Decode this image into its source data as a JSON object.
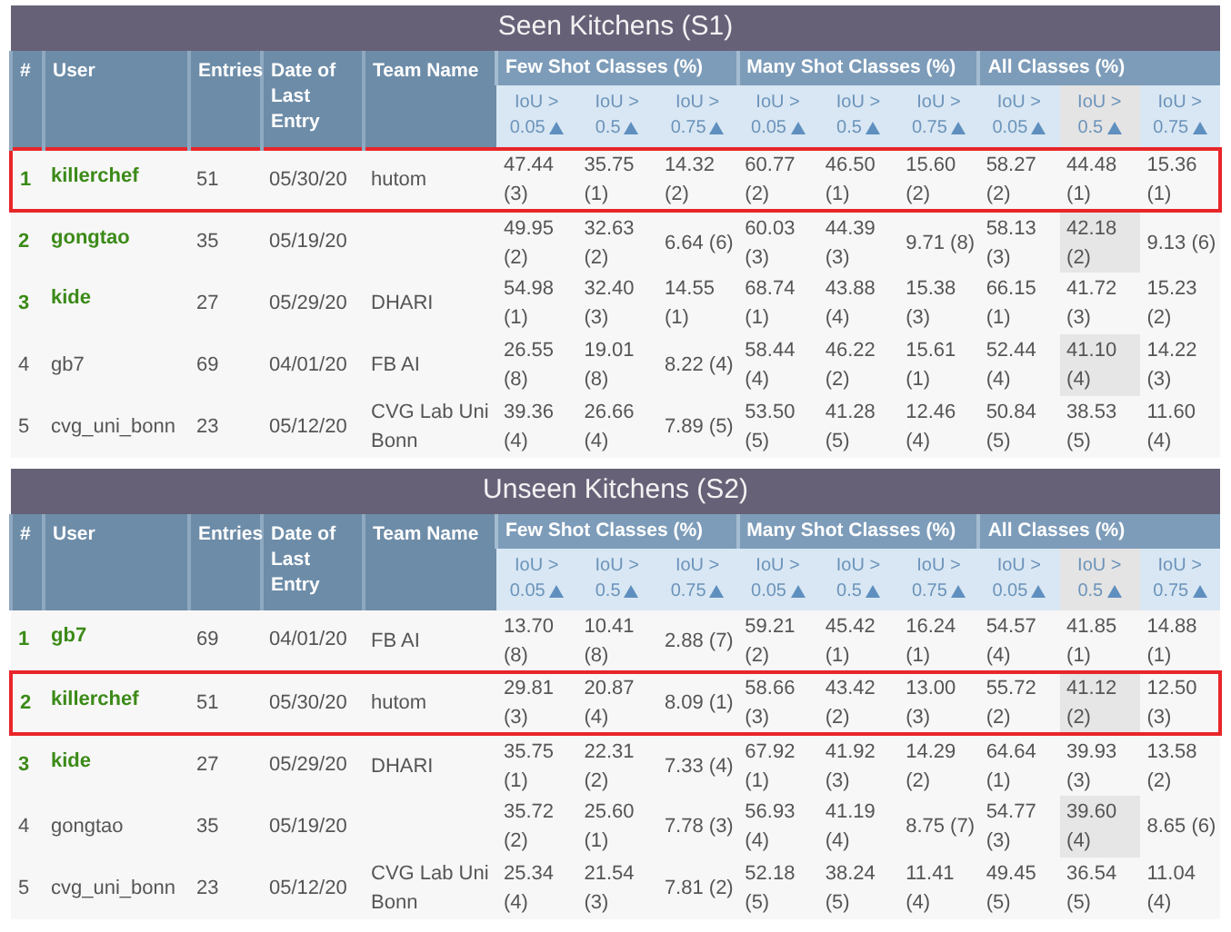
{
  "tables": [
    {
      "title": "Seen Kitchens (S1)",
      "columns": [
        "#",
        "User",
        "Entries",
        "Date of Last Entry",
        "Team Name"
      ],
      "groups": [
        {
          "label": "Few Shot Classes (%)",
          "subcolumns": [
            {
              "label": "IoU > 0.05",
              "sorted": false
            },
            {
              "label": "IoU > 0.5",
              "sorted": false
            },
            {
              "label": "IoU > 0.75",
              "sorted": false
            }
          ]
        },
        {
          "label": "Many Shot Classes (%)",
          "subcolumns": [
            {
              "label": "IoU > 0.05",
              "sorted": false
            },
            {
              "label": "IoU > 0.5",
              "sorted": false
            },
            {
              "label": "IoU > 0.75",
              "sorted": false
            }
          ]
        },
        {
          "label": "All Classes (%)",
          "subcolumns": [
            {
              "label": "IoU > 0.05",
              "sorted": false
            },
            {
              "label": "IoU > 0.5",
              "sorted": true
            },
            {
              "label": "IoU > 0.75",
              "sorted": false
            }
          ]
        }
      ],
      "rows": [
        {
          "rank": "1",
          "user": "killerchef",
          "entries": "51",
          "date": "05/30/20",
          "team": "hutom",
          "top": true,
          "highlighted": true,
          "scores": [
            "47.44 (3)",
            "35.75 (1)",
            "14.32 (2)",
            "60.77 (2)",
            "46.50 (1)",
            "15.60 (2)",
            "58.27 (2)",
            "44.48 (1)",
            "15.36 (1)"
          ]
        },
        {
          "rank": "2",
          "user": "gongtao",
          "entries": "35",
          "date": "05/19/20",
          "top": true,
          "highlighted": false,
          "scores": [
            "49.95 (2)",
            "32.63 (2)",
            "6.64 (6)",
            "60.03 (3)",
            "44.39 (3)",
            "9.71 (8)",
            "58.13 (3)",
            "42.18 (2)",
            "9.13 (6)"
          ]
        },
        {
          "rank": "3",
          "user": "kide",
          "entries": "27",
          "date": "05/29/20",
          "team": "DHARI",
          "top": true,
          "highlighted": false,
          "scores": [
            "54.98 (1)",
            "32.40 (3)",
            "14.55 (1)",
            "68.74 (1)",
            "43.88 (4)",
            "15.38 (3)",
            "66.15 (1)",
            "41.72 (3)",
            "15.23 (2)"
          ]
        },
        {
          "rank": "4",
          "user": "gb7",
          "entries": "69",
          "date": "04/01/20",
          "team": "FB AI",
          "top": false,
          "highlighted": false,
          "scores": [
            "26.55 (8)",
            "19.01 (8)",
            "8.22 (4)",
            "58.44 (4)",
            "46.22 (2)",
            "15.61 (1)",
            "52.44 (4)",
            "41.10 (4)",
            "14.22 (3)"
          ]
        },
        {
          "rank": "5",
          "user": "cvg_uni_bonn",
          "entries": "23",
          "date": "05/12/20",
          "team": "CVG Lab Uni Bonn",
          "top": false,
          "highlighted": false,
          "scores": [
            "39.36 (4)",
            "26.66 (4)",
            "7.89 (5)",
            "53.50 (5)",
            "41.28 (5)",
            "12.46 (4)",
            "50.84 (5)",
            "38.53 (5)",
            "11.60 (4)"
          ]
        }
      ]
    },
    {
      "title": "Unseen Kitchens (S2)",
      "columns": [
        "#",
        "User",
        "Entries",
        "Date of Last Entry",
        "Team Name"
      ],
      "groups": [
        {
          "label": "Few Shot Classes (%)",
          "subcolumns": [
            {
              "label": "IoU > 0.05",
              "sorted": false
            },
            {
              "label": "IoU > 0.5",
              "sorted": false
            },
            {
              "label": "IoU > 0.75",
              "sorted": false
            }
          ]
        },
        {
          "label": "Many Shot Classes (%)",
          "subcolumns": [
            {
              "label": "IoU > 0.05",
              "sorted": false
            },
            {
              "label": "IoU > 0.5",
              "sorted": false
            },
            {
              "label": "IoU > 0.75",
              "sorted": false
            }
          ]
        },
        {
          "label": "All Classes (%)",
          "subcolumns": [
            {
              "label": "IoU > 0.05",
              "sorted": false
            },
            {
              "label": "IoU > 0.5",
              "sorted": true
            },
            {
              "label": "IoU > 0.75",
              "sorted": false
            }
          ]
        }
      ],
      "rows": [
        {
          "rank": "1",
          "user": "gb7",
          "entries": "69",
          "date": "04/01/20",
          "team": "FB AI",
          "top": true,
          "highlighted": false,
          "scores": [
            "13.70 (8)",
            "10.41 (8)",
            "2.88 (7)",
            "59.21 (2)",
            "45.42 (1)",
            "16.24 (1)",
            "54.57 (4)",
            "41.85 (1)",
            "14.88 (1)"
          ]
        },
        {
          "rank": "2",
          "user": "killerchef",
          "entries": "51",
          "date": "05/30/20",
          "team": "hutom",
          "top": true,
          "highlighted": true,
          "scores": [
            "29.81 (3)",
            "20.87 (4)",
            "8.09 (1)",
            "58.66 (3)",
            "43.42 (2)",
            "13.00 (3)",
            "55.72 (2)",
            "41.12 (2)",
            "12.50 (3)"
          ]
        },
        {
          "rank": "3",
          "user": "kide",
          "entries": "27",
          "date": "05/29/20",
          "team": "DHARI",
          "top": true,
          "highlighted": false,
          "scores": [
            "35.75 (1)",
            "22.31 (2)",
            "7.33 (4)",
            "67.92 (1)",
            "41.92 (3)",
            "14.29 (2)",
            "64.64 (1)",
            "39.93 (3)",
            "13.58 (2)"
          ]
        },
        {
          "rank": "4",
          "user": "gongtao",
          "entries": "35",
          "date": "05/19/20",
          "top": false,
          "highlighted": false,
          "scores": [
            "35.72 (2)",
            "25.60 (1)",
            "7.78 (3)",
            "56.93 (4)",
            "41.19 (4)",
            "8.75 (7)",
            "54.77 (3)",
            "39.60 (4)",
            "8.65 (6)"
          ]
        },
        {
          "rank": "5",
          "user": "cvg_uni_bonn",
          "entries": "23",
          "date": "05/12/20",
          "team": "CVG Lab Uni Bonn",
          "top": false,
          "highlighted": false,
          "scores": [
            "25.34 (4)",
            "21.54 (3)",
            "7.81 (2)",
            "52.18 (5)",
            "38.24 (5)",
            "11.41 (4)",
            "49.45 (5)",
            "36.54 (5)",
            "11.04 (4)"
          ]
        }
      ]
    }
  ]
}
